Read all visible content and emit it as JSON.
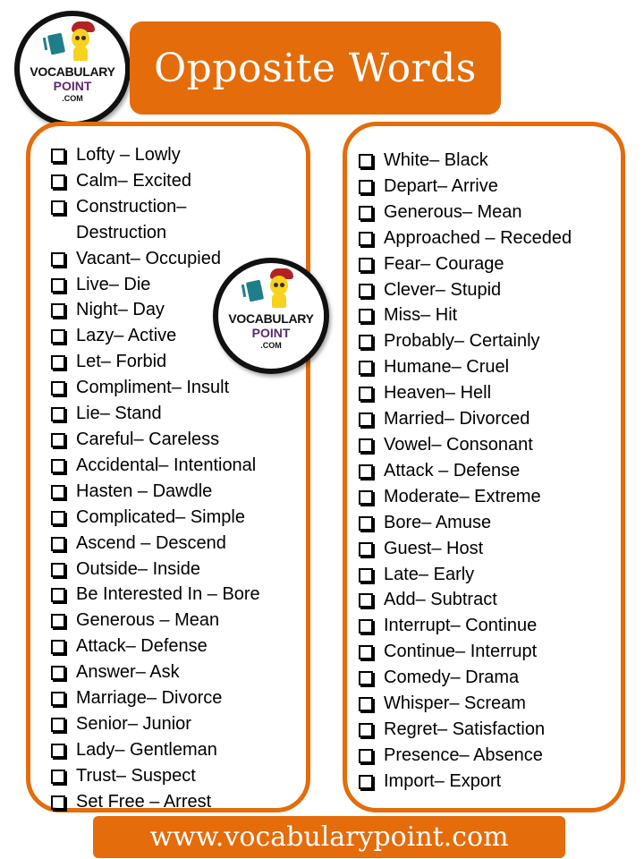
{
  "header": {
    "title": "Opposite Words"
  },
  "logo": {
    "line1": "VOCABULARY",
    "line2": "POINT",
    "line3": ".COM",
    "icon": "mascot-with-book-icon"
  },
  "colors": {
    "accent": "#E46C0A",
    "text": "#000000",
    "logo_purple": "#5B2A6E"
  },
  "left_list": [
    "Lofty – Lowly",
    "Calm– Excited",
    "Construction– Destruction",
    "Vacant– Occupied",
    "Live– Die",
    "Night– Day",
    "Lazy– Active",
    "Let– Forbid",
    "Compliment– Insult",
    "Lie– Stand",
    "Careful– Careless",
    "Accidental– Intentional",
    "Hasten – Dawdle",
    "Complicated– Simple",
    "Ascend – Descend",
    "Outside– Inside",
    "Be Interested In – Bore",
    "Generous – Mean",
    "Attack– Defense",
    "Answer– Ask",
    "Marriage– Divorce",
    "Senior– Junior",
    "Lady– Gentleman",
    "Trust– Suspect",
    "Set Free – Arrest"
  ],
  "right_list": [
    "White– Black",
    "Depart– Arrive",
    "Generous– Mean",
    "Approached – Receded",
    "Fear– Courage",
    "Clever– Stupid",
    "Miss– Hit",
    "Probably– Certainly",
    "Humane– Cruel",
    "Heaven– Hell",
    "Married– Divorced",
    "Vowel– Consonant",
    "Attack – Defense",
    "Moderate– Extreme",
    "Bore– Amuse",
    "Guest– Host",
    "Late– Early",
    "Add– Subtract",
    "Interrupt– Continue",
    "Continue– Interrupt",
    "Comedy– Drama",
    "Whisper– Scream",
    "Regret– Satisfaction",
    "Presence– Absence",
    "Import– Export"
  ],
  "footer": {
    "url": "www.vocabularypoint.com"
  }
}
